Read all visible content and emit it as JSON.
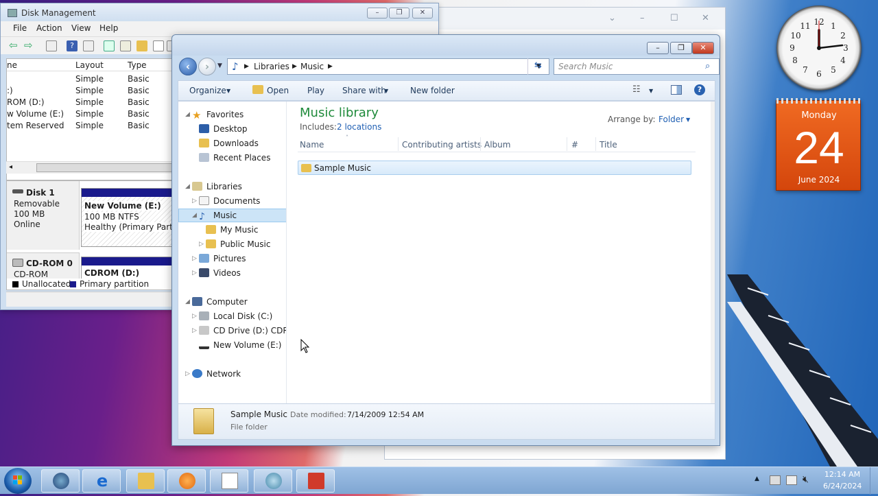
{
  "bgwin": {
    "minimize": "–",
    "maximize": "☐",
    "close": "✕",
    "chevron": "⌄"
  },
  "diskmgmt": {
    "title": "Disk Management",
    "menu": [
      "File",
      "Action",
      "View",
      "Help"
    ],
    "columns": [
      "ne",
      "Layout",
      "Type"
    ],
    "rows": [
      {
        "name": "",
        "layout": "Simple",
        "type": "Basic"
      },
      {
        "name": ":)",
        "layout": "Simple",
        "type": "Basic"
      },
      {
        "name": "ROM (D:)",
        "layout": "Simple",
        "type": "Basic"
      },
      {
        "name": "w Volume (E:)",
        "layout": "Simple",
        "type": "Basic"
      },
      {
        "name": "tem Reserved",
        "layout": "Simple",
        "type": "Basic"
      }
    ],
    "disk1": {
      "name": "Disk 1",
      "type": "Removable",
      "size": "100 MB",
      "state": "Online",
      "vol_name": "New Volume  (E:)",
      "vol_fs": "100 MB NTFS",
      "vol_status": "Healthy (Primary Partiti"
    },
    "cdrom": {
      "name": "CD-ROM 0",
      "type": "CD-ROM",
      "vol_name": "CDROM  (D:)"
    },
    "legend": {
      "unallocated": "Unallocated",
      "primary": "Primary partition"
    }
  },
  "explorer": {
    "breadcrumb": [
      "Libraries",
      "Music"
    ],
    "search_placeholder": "Search Music",
    "cmd": {
      "organize": "Organize",
      "open": "Open",
      "play": "Play",
      "share": "Share with",
      "newfolder": "New folder"
    },
    "nav": {
      "favorites": "Favorites",
      "desktop": "Desktop",
      "downloads": "Downloads",
      "recent": "Recent Places",
      "libraries": "Libraries",
      "documents": "Documents",
      "music": "Music",
      "mymusic": "My Music",
      "publicmusic": "Public Music",
      "pictures": "Pictures",
      "videos": "Videos",
      "computer": "Computer",
      "localdisk": "Local Disk (C:)",
      "cddrive": "CD Drive (D:) CDROM",
      "newvolume": "New Volume (E:)",
      "network": "Network"
    },
    "library_title": "Music library",
    "includes_label": "Includes:",
    "includes_link": "2 locations",
    "arrange_label": "Arrange by:",
    "arrange_value": "Folder",
    "columns": [
      "Name",
      "Contributing artists",
      "Album",
      "#",
      "Title"
    ],
    "items": [
      {
        "name": "Sample Music"
      }
    ],
    "details": {
      "name": "Sample Music",
      "modified_label": "Date modified:",
      "modified": "7/14/2009 12:54 AM",
      "type": "File folder"
    }
  },
  "gadgets": {
    "calendar": {
      "day": "Monday",
      "date": "24",
      "month": "June 2024"
    }
  },
  "taskbar": {
    "time": "12:14 AM",
    "date": "6/24/2024"
  },
  "colors": {
    "accent": "#2a62b0",
    "title_green": "#1e8a3a",
    "link": "#1f5fb3",
    "calendar": "#e85a16"
  }
}
